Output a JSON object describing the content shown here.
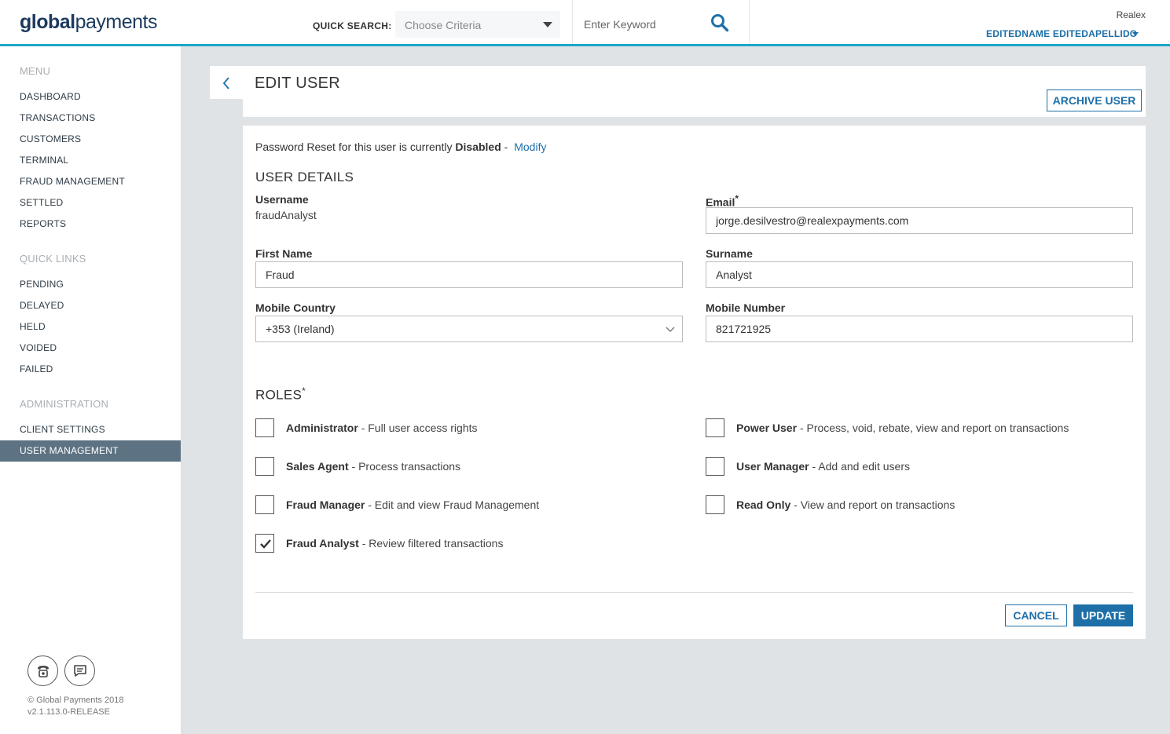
{
  "header": {
    "logo_bold": "global",
    "logo_light": "payments",
    "quick_search_label": "QUICK SEARCH:",
    "criteria_placeholder": "Choose Criteria",
    "keyword_placeholder": "Enter Keyword",
    "merchant": "Realex",
    "user_name": "EDITEDNAME EDITEDAPELLIDO"
  },
  "sidebar": {
    "menu_heading": "MENU",
    "menu_items": [
      "DASHBOARD",
      "TRANSACTIONS",
      "CUSTOMERS",
      "TERMINAL",
      "FRAUD MANAGEMENT",
      "SETTLED",
      "REPORTS"
    ],
    "quick_links_heading": "QUICK LINKS",
    "quick_links": [
      "PENDING",
      "DELAYED",
      "HELD",
      "VOIDED",
      "FAILED"
    ],
    "admin_heading": "ADMINISTRATION",
    "admin_items": [
      "CLIENT SETTINGS",
      "USER MANAGEMENT"
    ],
    "active_item": "USER MANAGEMENT",
    "icons": [
      "phone-icon",
      "chat-icon"
    ],
    "copyright": "© Global Payments 2018",
    "version": "v2.1.113.0-RELEASE"
  },
  "page": {
    "title": "EDIT USER",
    "archive_label": "ARCHIVE USER"
  },
  "password_reset": {
    "prefix": "Password Reset for this user is currently",
    "status": "Disabled",
    "separator": "-",
    "modify_label": "Modify"
  },
  "user_details": {
    "heading": "USER DETAILS",
    "username_label": "Username",
    "username_value": "fraudAnalyst",
    "email_label": "Email",
    "email_value": "jorge.desilvestro@realexpayments.com",
    "first_name_label": "First Name",
    "first_name_value": "Fraud",
    "surname_label": "Surname",
    "surname_value": "Analyst",
    "mobile_country_label": "Mobile Country",
    "mobile_country_value": "+353 (Ireland)",
    "mobile_number_label": "Mobile Number",
    "mobile_number_value": "821721925",
    "required_mark": "*"
  },
  "roles": {
    "heading": "ROLES",
    "items": [
      {
        "name": "Administrator",
        "desc": "- Full user access rights",
        "checked": false
      },
      {
        "name": "Power User",
        "desc": "- Process, void, rebate, view and report on transactions",
        "checked": false
      },
      {
        "name": "Sales Agent",
        "desc": "- Process transactions",
        "checked": false
      },
      {
        "name": "User Manager",
        "desc": "- Add and edit users",
        "checked": false
      },
      {
        "name": "Fraud Manager",
        "desc": "- Edit and view Fraud Management",
        "checked": false
      },
      {
        "name": "Read Only",
        "desc": "- View and report on transactions",
        "checked": false
      },
      {
        "name": "Fraud Analyst",
        "desc": "- Review filtered transactions",
        "checked": true
      }
    ]
  },
  "actions": {
    "cancel_label": "CANCEL",
    "update_label": "UPDATE"
  },
  "colors": {
    "accent": "#1e6fa8",
    "header_border": "#1ba7c8",
    "sidebar_active": "#5d7383",
    "background": "#dfe3e6"
  }
}
